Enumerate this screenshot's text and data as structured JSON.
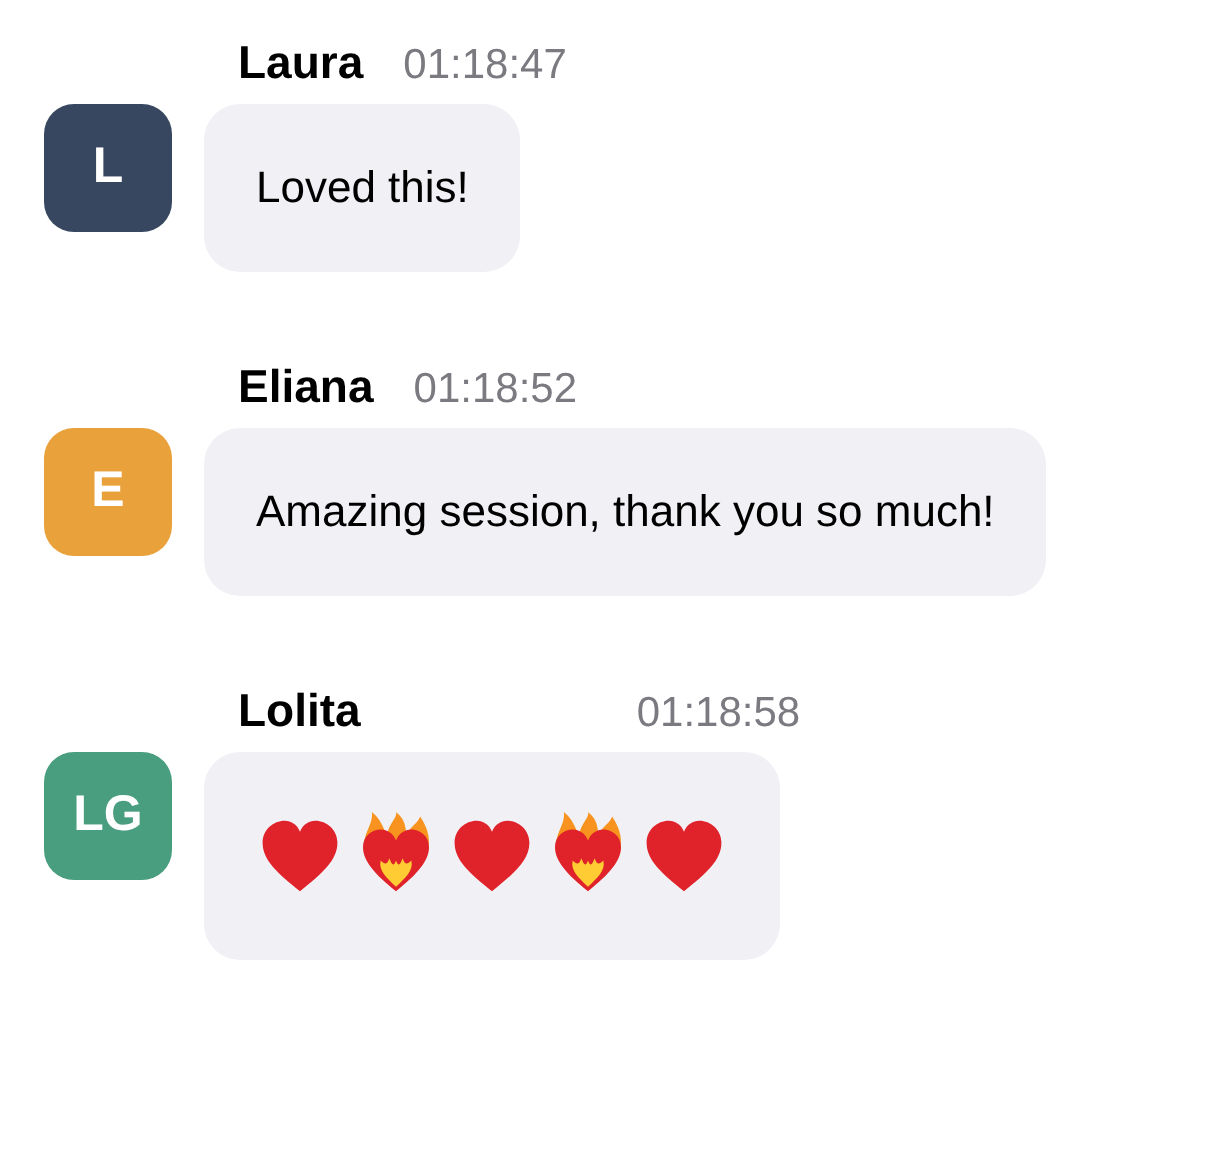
{
  "messages": [
    {
      "author": "Laura",
      "time": "01:18:47",
      "avatar": {
        "initials": "L",
        "color": "#37475f"
      },
      "kind": "text",
      "text": "Loved this!"
    },
    {
      "author": "Eliana",
      "time": "01:18:52",
      "avatar": {
        "initials": "E",
        "color": "#e9a23b"
      },
      "kind": "text",
      "text": "Amazing session, thank you so much!"
    },
    {
      "author": "Lolita",
      "time": "01:18:58",
      "avatar": {
        "initials": "LG",
        "color": "#4a9e80"
      },
      "kind": "emoji",
      "emojis": [
        {
          "kind": "heart"
        },
        {
          "kind": "heart_on_fire"
        },
        {
          "kind": "heart"
        },
        {
          "kind": "heart_on_fire"
        },
        {
          "kind": "heart"
        }
      ]
    }
  ]
}
